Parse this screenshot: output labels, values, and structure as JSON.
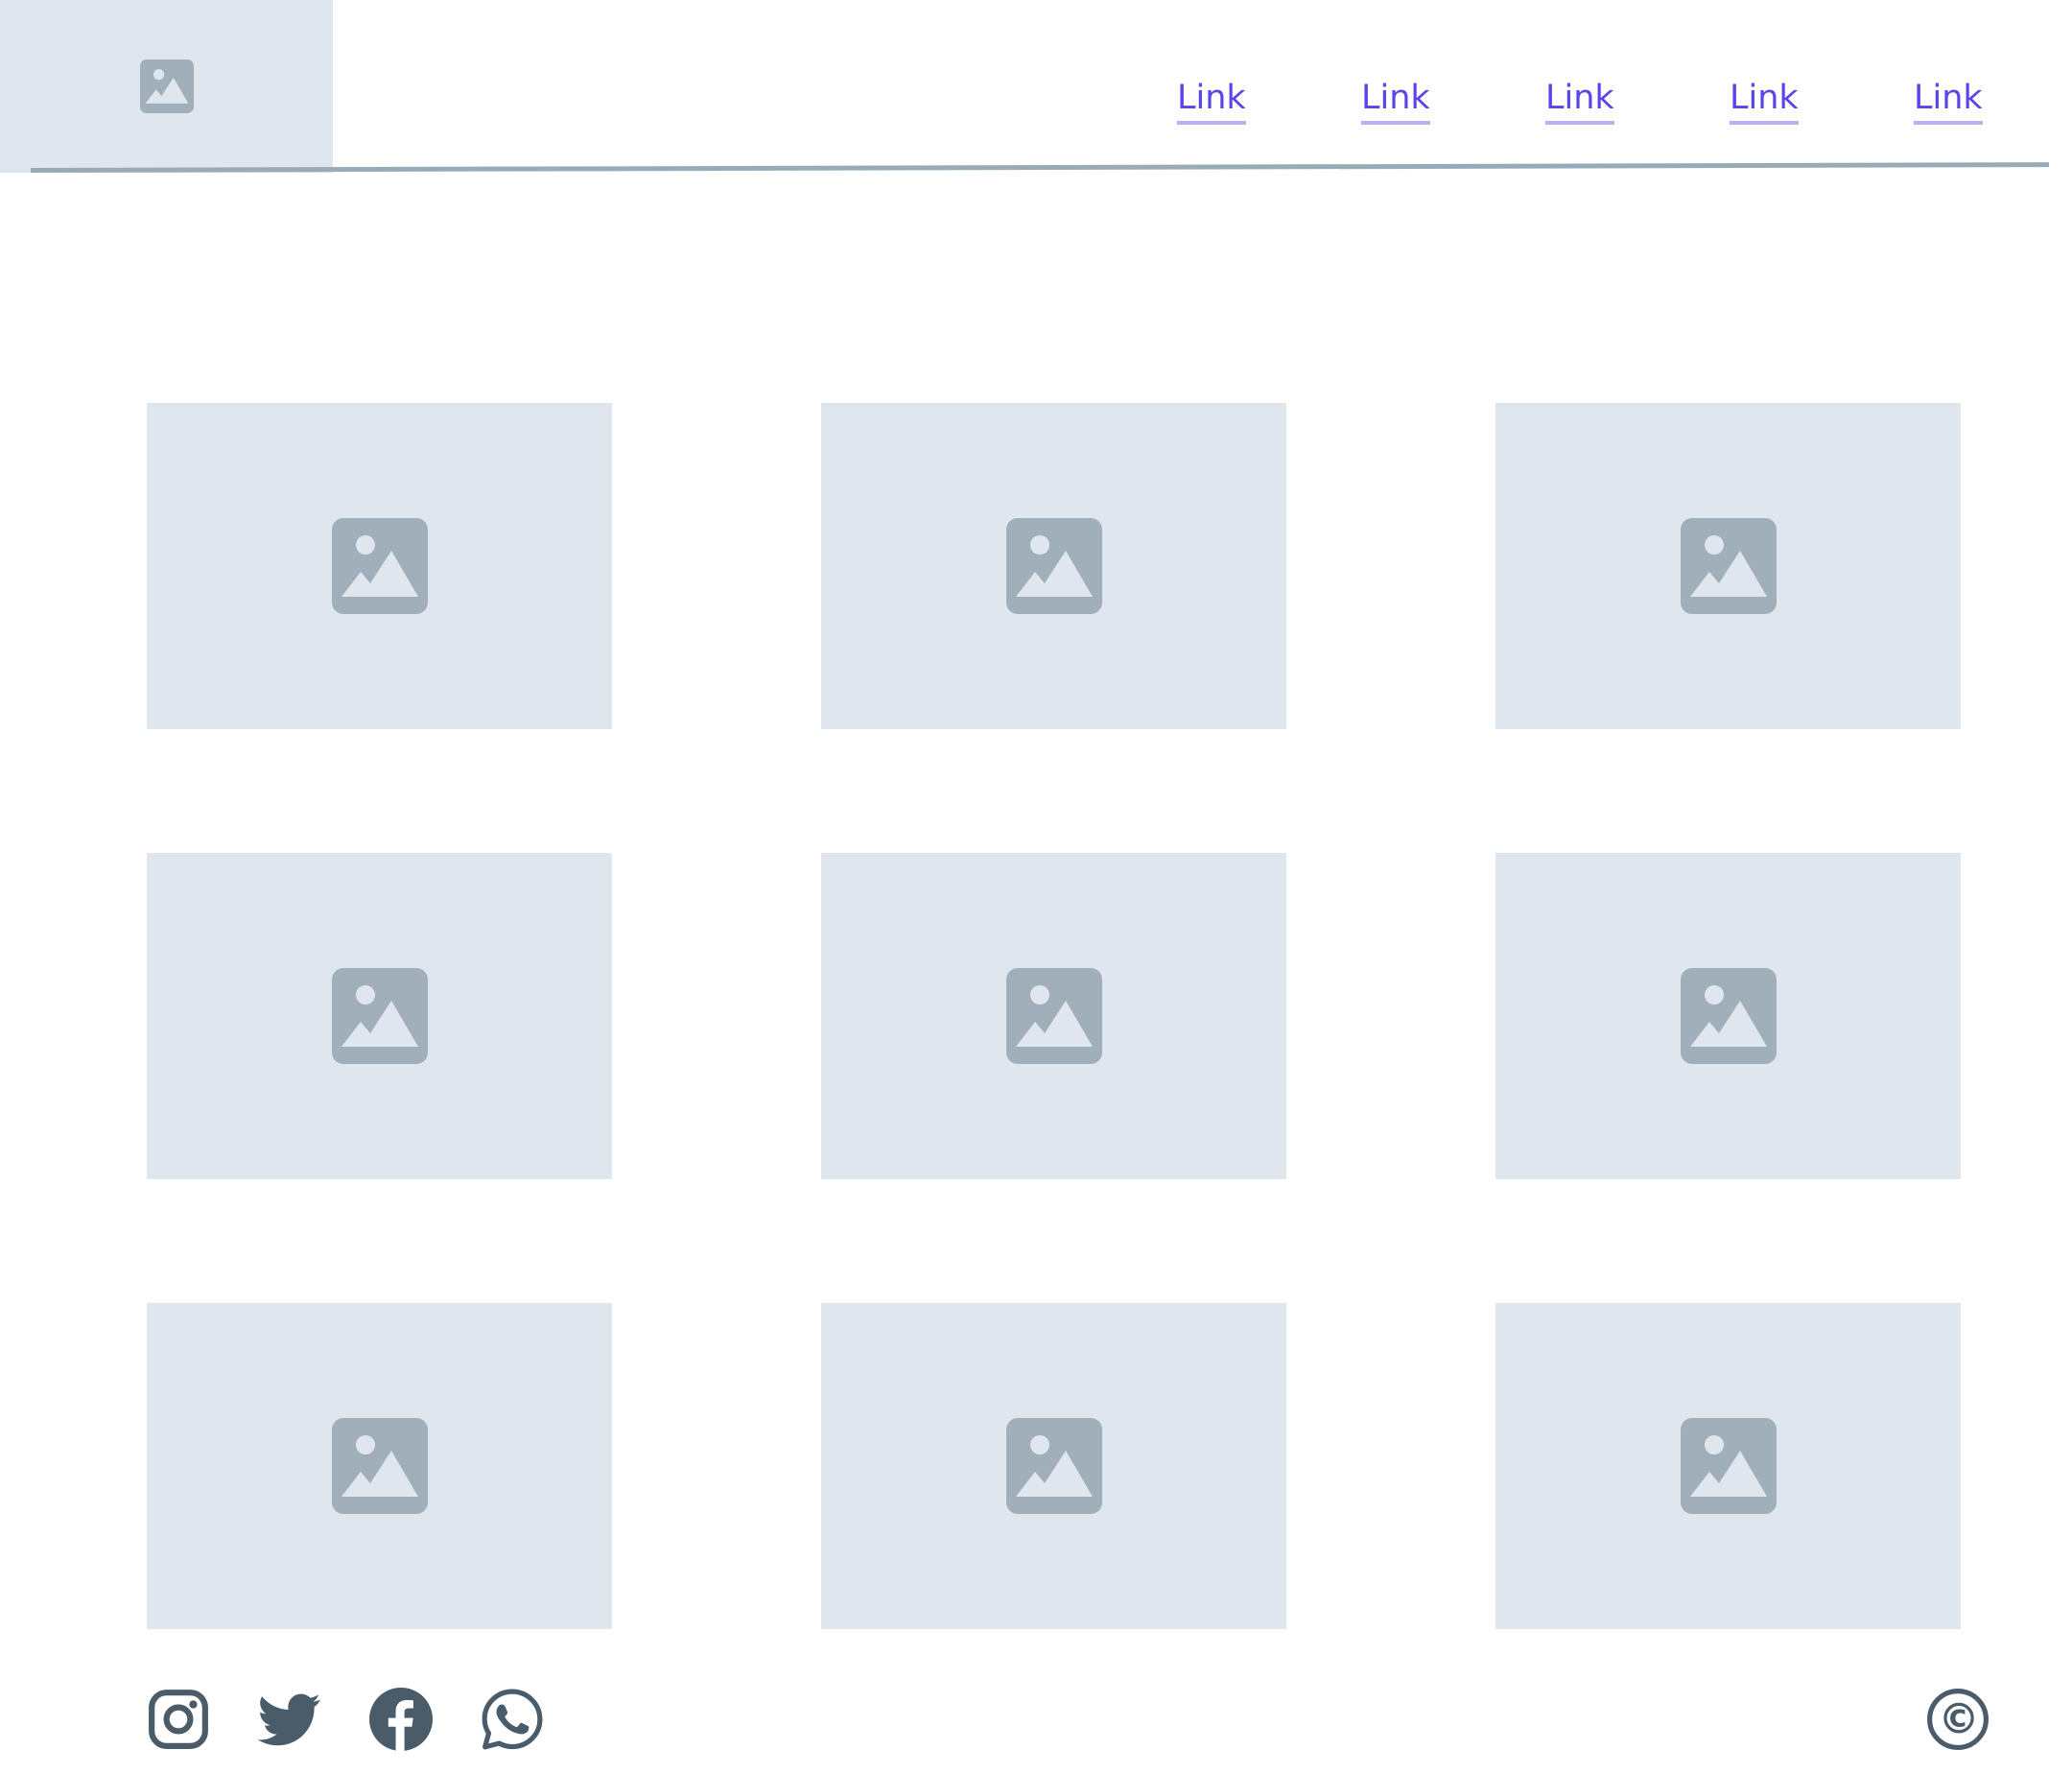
{
  "header": {
    "logo_icon": "image-placeholder-icon",
    "links": [
      "Link",
      "Link",
      "Link",
      "Link",
      "Link"
    ],
    "link_color": "#5a46e8"
  },
  "gallery": {
    "tile_icon": "image-placeholder-icon",
    "tile_count": 9
  },
  "footer": {
    "social_icons": [
      "instagram-icon",
      "twitter-icon",
      "facebook-icon",
      "whatsapp-icon"
    ],
    "copyright_symbol": "©"
  },
  "colors": {
    "placeholder_bg": "#e0e6ee",
    "placeholder_icon": "#a0afba",
    "icon_dark": "#4a5b6a",
    "rule": "#9aabb8"
  }
}
